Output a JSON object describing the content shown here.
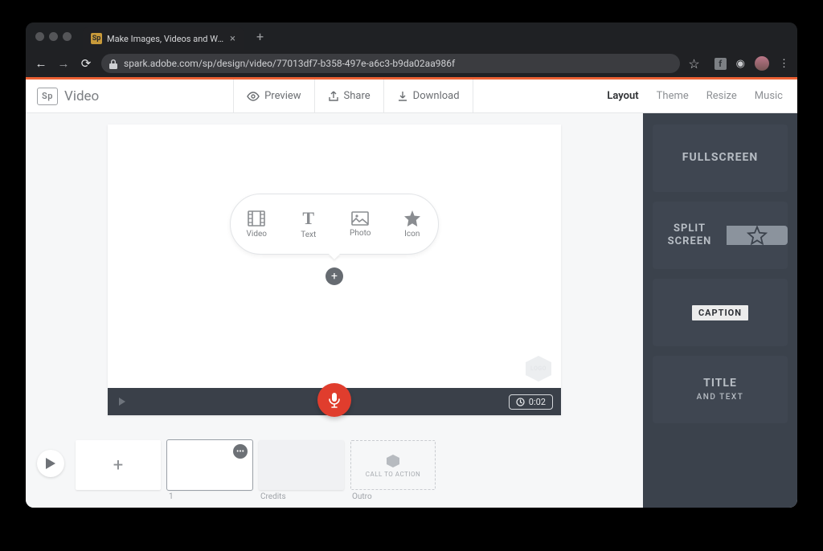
{
  "browser": {
    "tab_title": "Make Images, Videos and Web…",
    "favicon_text": "Sp",
    "url": "spark.adobe.com/sp/design/video/77013df7-b358-497e-a6c3-b9da02aa986f"
  },
  "header": {
    "brand_logo": "Sp",
    "brand_name": "Video",
    "preview": "Preview",
    "share": "Share",
    "download": "Download",
    "nav": {
      "layout": "Layout",
      "theme": "Theme",
      "resize": "Resize",
      "music": "Music"
    }
  },
  "insert": {
    "video": "Video",
    "text": "Text",
    "photo": "Photo",
    "icon": "Icon"
  },
  "logo_badge": "LOGO",
  "playback": {
    "duration": "0:02"
  },
  "timeline": {
    "slide1": "1",
    "credits": "Credits",
    "outro": "Outro",
    "cta": "CALL TO ACTION"
  },
  "layouts": {
    "fullscreen": "FULLSCREEN",
    "split_a": "SPLIT",
    "split_b": "SCREEN",
    "caption": "CAPTION",
    "title": "TITLE",
    "title_sub": "AND TEXT"
  }
}
